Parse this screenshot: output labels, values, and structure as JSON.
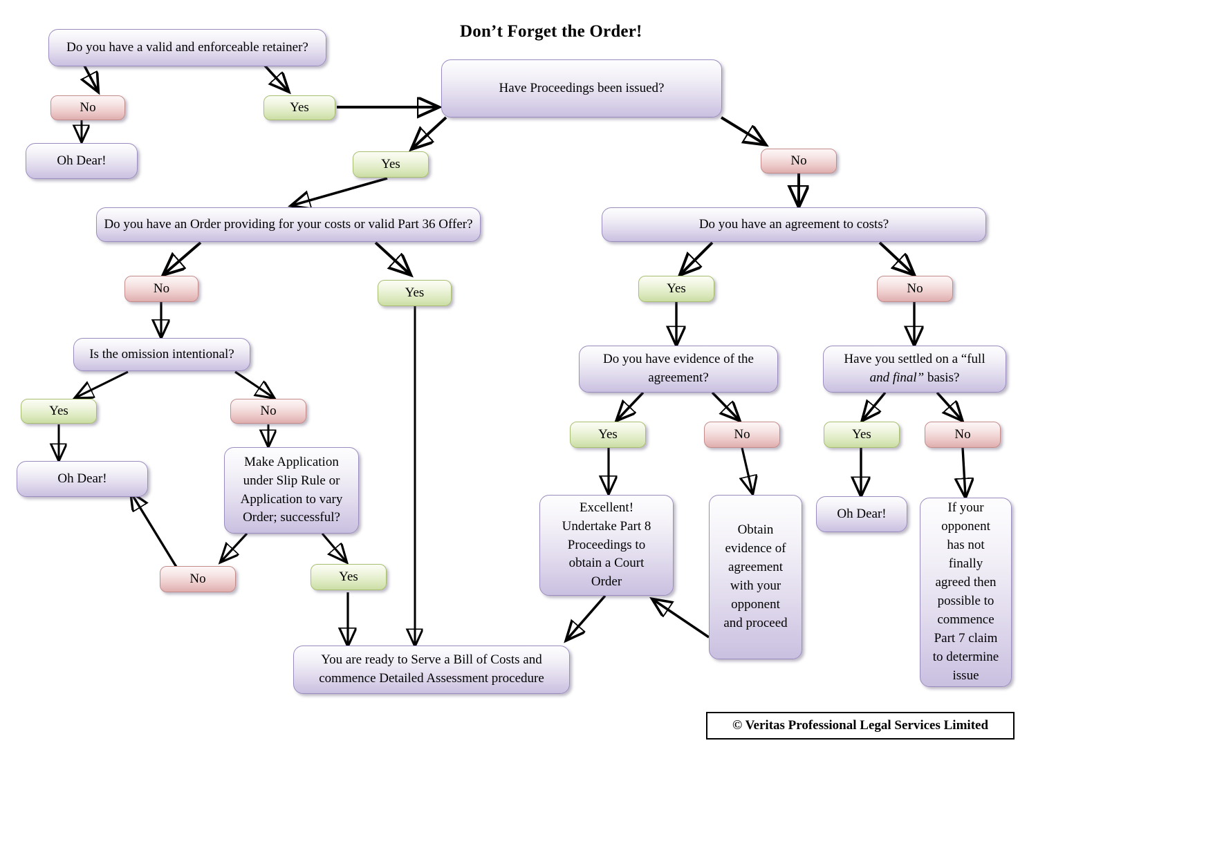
{
  "title": "Don’t Forget the Order!",
  "footer": "© Veritas Professional Legal Services Limited",
  "colors": {
    "purple_border": "#9b8cc0",
    "purple_fill": "#e2dcee",
    "green_border": "#a8bf72",
    "green_fill": "#ddeac0",
    "red_border": "#c48b8b",
    "red_fill": "#eecccc",
    "arrow": "#000000",
    "text": "#000000"
  },
  "nodes": {
    "q_retainer": "Do you have a valid and enforceable retainer?",
    "retainer_no": "No",
    "retainer_yes": "Yes",
    "ohdear_retainer": "Oh Dear!",
    "q_proceedings": "Have Proceedings been issued?",
    "proceedings_yes": "Yes",
    "proceedings_no": "No",
    "q_order": "Do you have an Order providing for your costs or valid Part 36 Offer?",
    "order_no": "No",
    "order_yes": "Yes",
    "q_omission": "Is the omission intentional?",
    "omission_yes": "Yes",
    "omission_no": "No",
    "ohdear_omission": "Oh Dear!",
    "make_application_line1": "Make Application",
    "make_application_line2": "under Slip Rule or",
    "make_application_line3": "Application to vary",
    "make_application_line4": "Order; successful?",
    "application_no": "No",
    "application_yes": "Yes",
    "ready_line1": "You are ready to Serve a Bill of Costs and",
    "ready_line2": "commence Detailed Assessment procedure",
    "q_agreement": "Do you have an agreement to costs?",
    "agreement_yes": "Yes",
    "agreement_no": "No",
    "q_evidence_line1": "Do you have evidence of the",
    "q_evidence_line2": "agreement?",
    "evidence_yes": "Yes",
    "evidence_no": "No",
    "excellent_line1": "Excellent!",
    "excellent_line2": "Undertake Part 8",
    "excellent_line3": "Proceedings to",
    "excellent_line4": "obtain a Court",
    "excellent_line5": "Order",
    "obtain_line1": "Obtain",
    "obtain_line2": "evidence of",
    "obtain_line3": "agreement",
    "obtain_line4": "with your",
    "obtain_line5": "opponent",
    "obtain_line6": "and proceed",
    "q_settled_line1": "Have you settled on a “full",
    "q_settled_line2a": "and final”",
    "q_settled_line2b": " basis?",
    "settled_yes": "Yes",
    "settled_no": "No",
    "ohdear_settled": "Oh Dear!",
    "part7_line1": "If your",
    "part7_line2": "opponent",
    "part7_line3": "has not",
    "part7_line4": "finally",
    "part7_line5": "agreed then",
    "part7_line6": "possible to",
    "part7_line7": "commence",
    "part7_line8": "Part 7 claim",
    "part7_line9": "to determine",
    "part7_line10": "issue"
  }
}
